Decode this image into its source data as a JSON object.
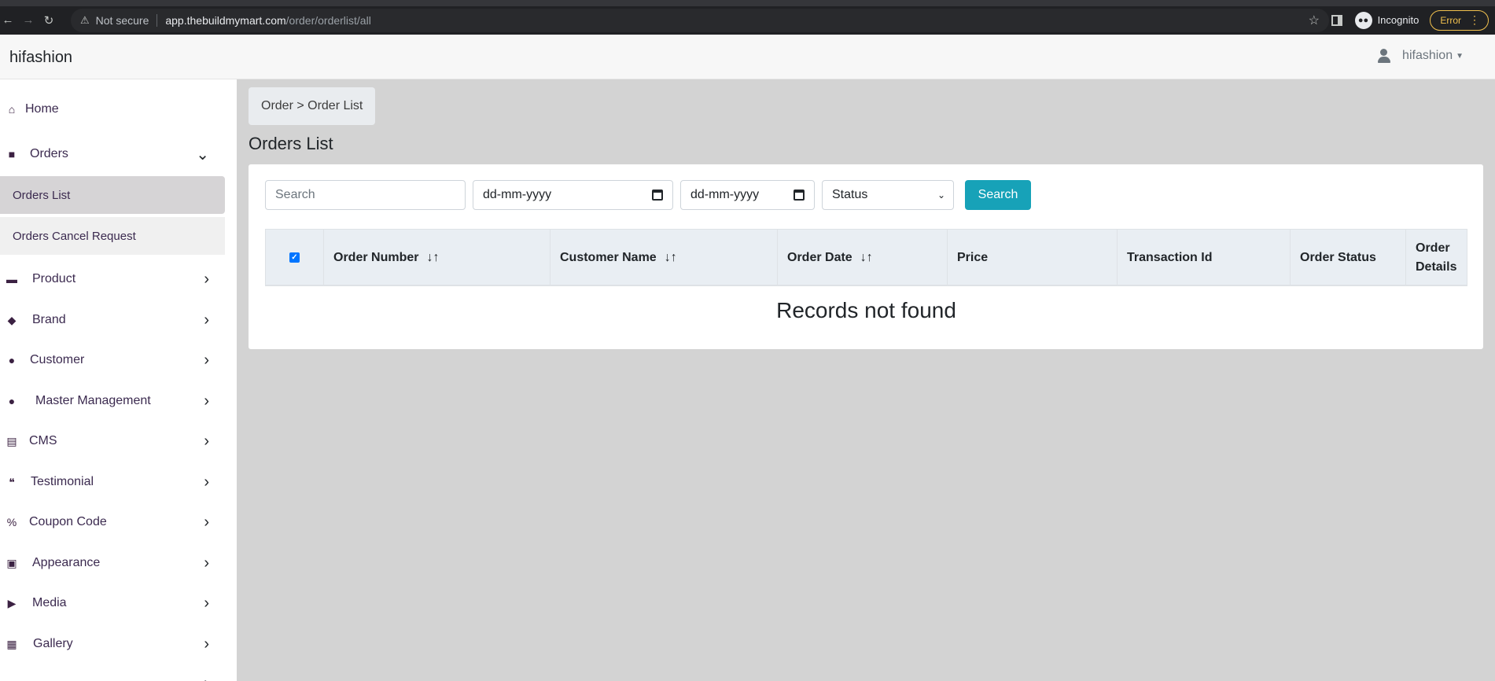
{
  "browser": {
    "security_label": "Not secure",
    "url_host": "app.thebuildmymart.com",
    "url_path": "/order/orderlist/all",
    "profile_label": "Incognito",
    "error_label": "Error"
  },
  "header": {
    "brand": "hifashion",
    "user": "hifashion"
  },
  "sidebar": {
    "items": [
      {
        "label": "Home",
        "icon": "home-icon"
      },
      {
        "label": "Orders",
        "icon": "shopping-bag-icon",
        "expanded": true
      },
      {
        "label": "Product",
        "icon": "archive-icon"
      },
      {
        "label": "Brand",
        "icon": "tags-icon"
      },
      {
        "label": "Customer",
        "icon": "user-icon"
      },
      {
        "label": "Master Management",
        "icon": "user-cog-icon"
      },
      {
        "label": "CMS",
        "icon": "file-icon"
      },
      {
        "label": "Testimonial",
        "icon": "quote-icon"
      },
      {
        "label": "Coupon Code",
        "icon": "percent-icon"
      },
      {
        "label": "Appearance",
        "icon": "image-icon"
      },
      {
        "label": "Media",
        "icon": "play-circle-icon"
      },
      {
        "label": "Gallery",
        "icon": "images-icon"
      }
    ],
    "order_subitems": [
      "Orders List",
      "Orders Cancel Request"
    ]
  },
  "main": {
    "breadcrumb": "Order > Order List",
    "title": "Orders List",
    "filters": {
      "search_placeholder": "Search",
      "date_from_placeholder": "dd-mm-yyyy",
      "date_to_placeholder": "dd-mm-yyyy",
      "status_selected": "Status",
      "search_button": "Search"
    },
    "table": {
      "columns": [
        "Order Number",
        "Customer Name",
        "Order Date",
        "Price",
        "Transaction Id",
        "Order Status",
        "Order Details"
      ],
      "sort_glyph": "↓↑",
      "empty_message": "Records not found"
    }
  }
}
